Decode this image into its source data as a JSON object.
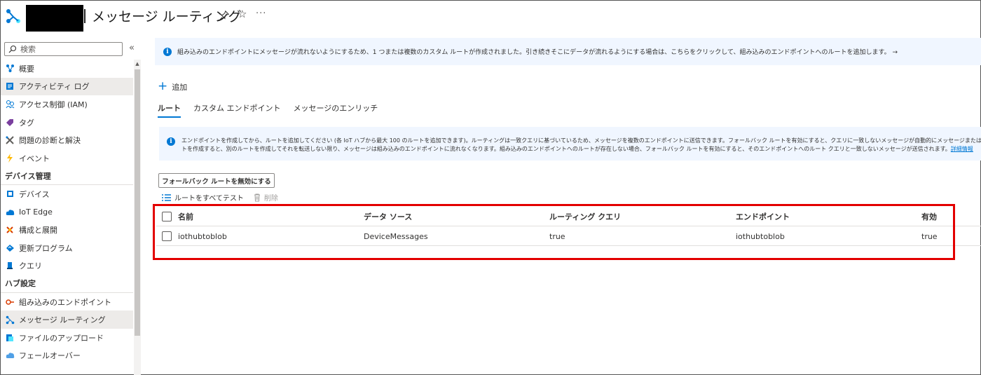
{
  "header": {
    "title": "メッセージ ルーティング",
    "pin_label": "pin",
    "star_label": "☆",
    "more_label": "···"
  },
  "sidebar": {
    "search_placeholder": "検索",
    "collapse_label": "«",
    "items": [
      {
        "label": "概要",
        "icon": "overview-icon",
        "color": "#0078d4"
      },
      {
        "label": "アクティビティ ログ",
        "icon": "activity-log-icon",
        "color": "#0078d4",
        "active": true
      },
      {
        "label": "アクセス制御 (IAM)",
        "icon": "iam-icon",
        "color": "#0078d4"
      },
      {
        "label": "タグ",
        "icon": "tag-icon",
        "color": "#7a3f9e"
      },
      {
        "label": "問題の診断と解決",
        "icon": "diagnose-icon",
        "color": "#605e5c"
      },
      {
        "label": "イベント",
        "icon": "event-icon",
        "color": "#ffb900"
      }
    ],
    "sections": [
      {
        "title": "デバイス管理",
        "items": [
          {
            "label": "デバイス",
            "icon": "device-icon",
            "color": "#0078d4"
          },
          {
            "label": "IoT Edge",
            "icon": "iot-edge-icon",
            "color": "#0078d4"
          },
          {
            "label": "構成と展開",
            "icon": "configuration-icon",
            "color": "#d83b01"
          },
          {
            "label": "更新プログラム",
            "icon": "update-icon",
            "color": "#0078d4"
          },
          {
            "label": "クエリ",
            "icon": "query-icon",
            "color": "#0078d4"
          }
        ]
      },
      {
        "title": "ハブ設定",
        "items": [
          {
            "label": "組み込みのエンドポイント",
            "icon": "endpoint-icon",
            "color": "#d83b01"
          },
          {
            "label": "メッセージ ルーティング",
            "icon": "routing-icon",
            "color": "#0078d4",
            "active": true
          },
          {
            "label": "ファイルのアップロード",
            "icon": "file-upload-icon",
            "color": "#0078d4"
          },
          {
            "label": "フェールオーバー",
            "icon": "failover-icon",
            "color": "#0078d4"
          }
        ]
      }
    ]
  },
  "banner_top": {
    "text": "組み込みのエンドポイントにメッセージが流れないようにするため、1 つまたは複数のカスタム ルートが作成されました。引き続きそこにデータが流れるようにする場合は、こちらをクリックして、組み込みのエンドポイントへのルートを追加します。 →"
  },
  "toolbar": {
    "add_label": "追加"
  },
  "tabs": [
    {
      "label": "ルート",
      "active": true
    },
    {
      "label": "カスタム エンドポイント"
    },
    {
      "label": "メッセージのエンリッチ"
    }
  ],
  "info_banner": {
    "line1": "エンドポイントを作成してから、ルートを追加してください (各 IoT ハブから最大 100 のルートを追加できます)。ルーティングは一致クエリに基づいているため、メッセージを複数のエンドポイントに送信できます。フォールバック ルートを有効にすると、クエリに一致しないメッセージが自動的にメッセージまたはイベントに",
    "line2": "トを作成すると、別のルートを作成してそれを転送しない限り、メッセージは組み込みのエンドポイントに流れなくなります。組み込みのエンドポイントへのルートが存在しない場合、フォールバック ルートを有効にすると、そのエンドポイントへのルート クエリと一致しないメッセージが送信されます。",
    "link": "詳細情報"
  },
  "fallback_button": "フォールバック ルートを無効にする",
  "route_toolbar": {
    "test_all": "ルートをすべてテスト",
    "delete": "削除"
  },
  "table": {
    "columns": [
      "名前",
      "データ ソース",
      "ルーティング クエリ",
      "エンドポイント",
      "有効"
    ],
    "rows": [
      [
        "iothubtoblob",
        "DeviceMessages",
        "true",
        "iothubtoblob",
        "true"
      ]
    ]
  },
  "colors": {
    "accent": "#0078d4",
    "highlight": "#e30000",
    "banner_bg": "#f0f6ff"
  }
}
